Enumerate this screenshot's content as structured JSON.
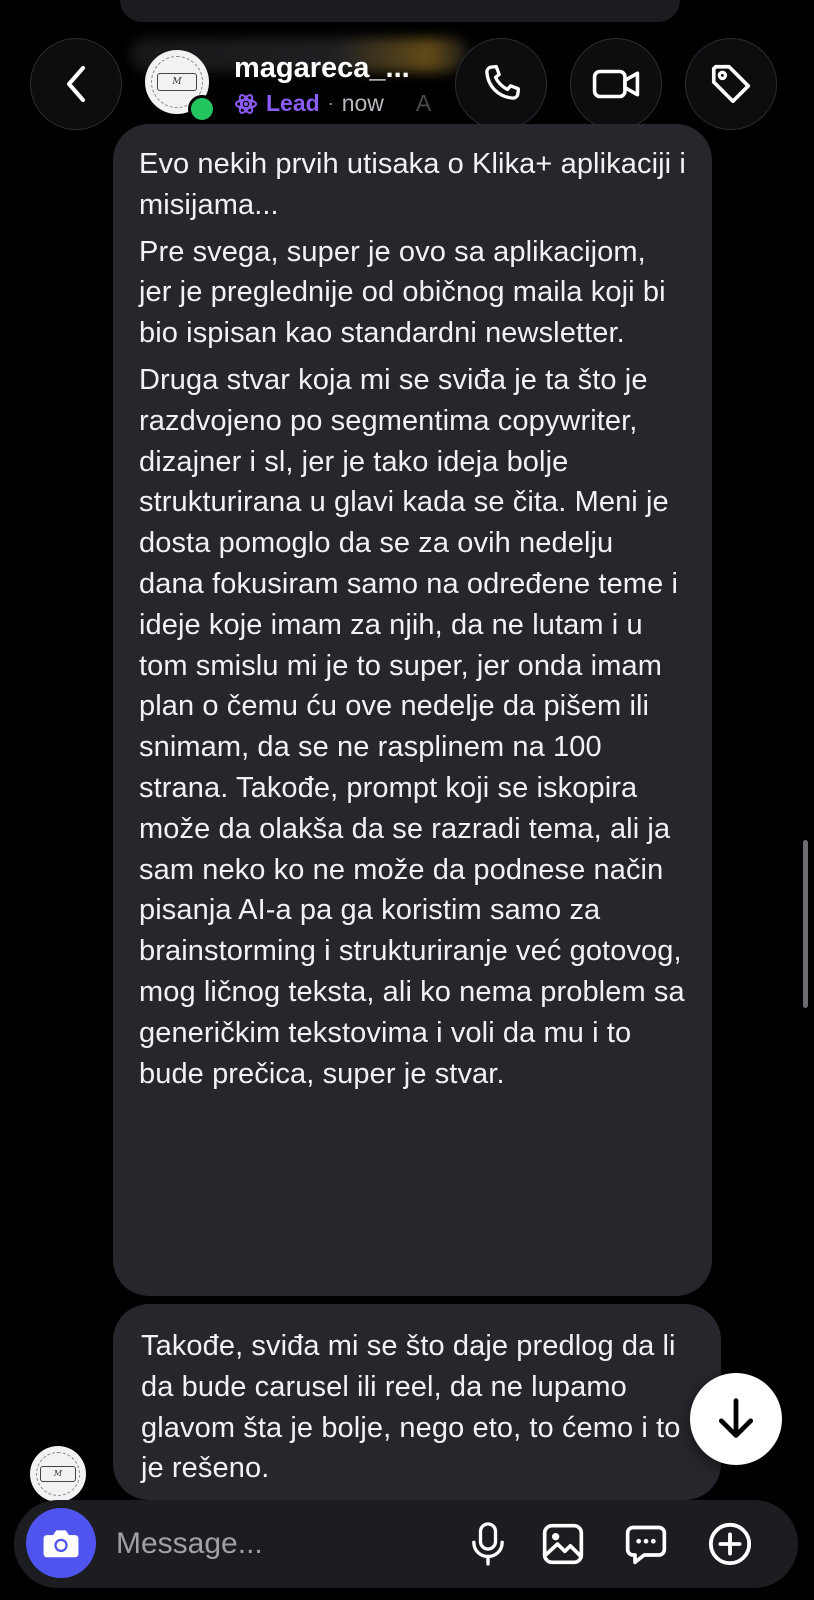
{
  "header": {
    "username": "magareca_...",
    "label": "Lead",
    "separator": "·",
    "time": "now",
    "faded_char": "A"
  },
  "messages": [
    {
      "paragraphs": [
        "Evo nekih prvih utisaka o Klika+ aplikaciji i misijama...",
        "Pre svega, super je ovo sa aplikacijom, jer je preglednije od običnog maila koji bi bio ispisan kao standardni newsletter.",
        "Druga stvar koja mi se sviđa je ta što je razdvojeno po segmentima copywriter, dizajner i sl, jer je tako ideja bolje strukturirana u glavi kada se čita. Meni je dosta pomoglo da se za ovih nedelju dana fokusiram samo na određene teme i ideje koje imam za njih, da ne lutam i u tom smislu mi je to super, jer onda imam plan o čemu ću ove nedelje da pišem ili snimam, da se ne rasplinem na 100 strana. Takođe, prompt koji se iskopira može da olakša da se razradi tema, ali ja sam neko ko ne može da podnese način pisanja AI-a pa ga koristim samo za brainstorming i strukturiranje već gotovog, mog ličnog teksta, ali ko nema problem sa generičkim tekstovima i voli da mu i to bude prečica, super je stvar."
      ]
    },
    {
      "paragraphs": [
        "Takođe, sviđa mi se što daje predlog da li da bude carusel ili reel, da ne lupamo glavom šta je bolje, nego eto, to ćemo i to je rešeno."
      ]
    }
  ],
  "composer": {
    "placeholder": "Message..."
  },
  "colors": {
    "background": "#000000",
    "bubble": "#26272c",
    "lead_accent": "#8b5cf6",
    "online": "#22c55e",
    "camera_button": "#4f54ef"
  },
  "icons": [
    "back-icon",
    "phone-icon",
    "video-camera-icon",
    "tag-icon",
    "lead-badge-icon",
    "arrow-down-icon",
    "camera-icon",
    "microphone-icon",
    "gallery-icon",
    "sticker-chat-icon",
    "plus-icon"
  ]
}
